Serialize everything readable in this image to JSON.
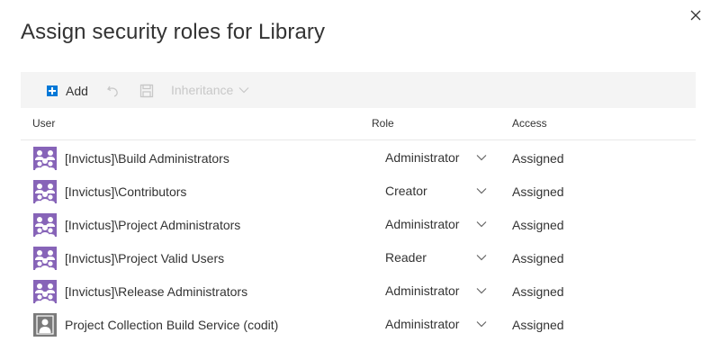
{
  "dialog": {
    "title": "Assign security roles for Library"
  },
  "toolbar": {
    "add_label": "Add",
    "inheritance_label": "Inheritance"
  },
  "columns": {
    "user": "User",
    "role": "Role",
    "access": "Access"
  },
  "colors": {
    "accent": "#0078d7",
    "group_avatar": "#8764b8",
    "user_avatar": "#7a7a7a",
    "toolbar_bg": "#f4f4f4",
    "disabled_text": "#c8c8c8"
  },
  "rows": [
    {
      "user": "[Invictus]\\Build Administrators",
      "role": "Administrator",
      "access": "Assigned",
      "avatar": "group-icon"
    },
    {
      "user": "[Invictus]\\Contributors",
      "role": "Creator",
      "access": "Assigned",
      "avatar": "group-icon"
    },
    {
      "user": "[Invictus]\\Project Administrators",
      "role": "Administrator",
      "access": "Assigned",
      "avatar": "group-icon"
    },
    {
      "user": "[Invictus]\\Project Valid Users",
      "role": "Reader",
      "access": "Assigned",
      "avatar": "group-icon"
    },
    {
      "user": "[Invictus]\\Release Administrators",
      "role": "Administrator",
      "access": "Assigned",
      "avatar": "group-icon"
    },
    {
      "user": "Project Collection Build Service (codit)",
      "role": "Administrator",
      "access": "Assigned",
      "avatar": "user-icon"
    }
  ]
}
